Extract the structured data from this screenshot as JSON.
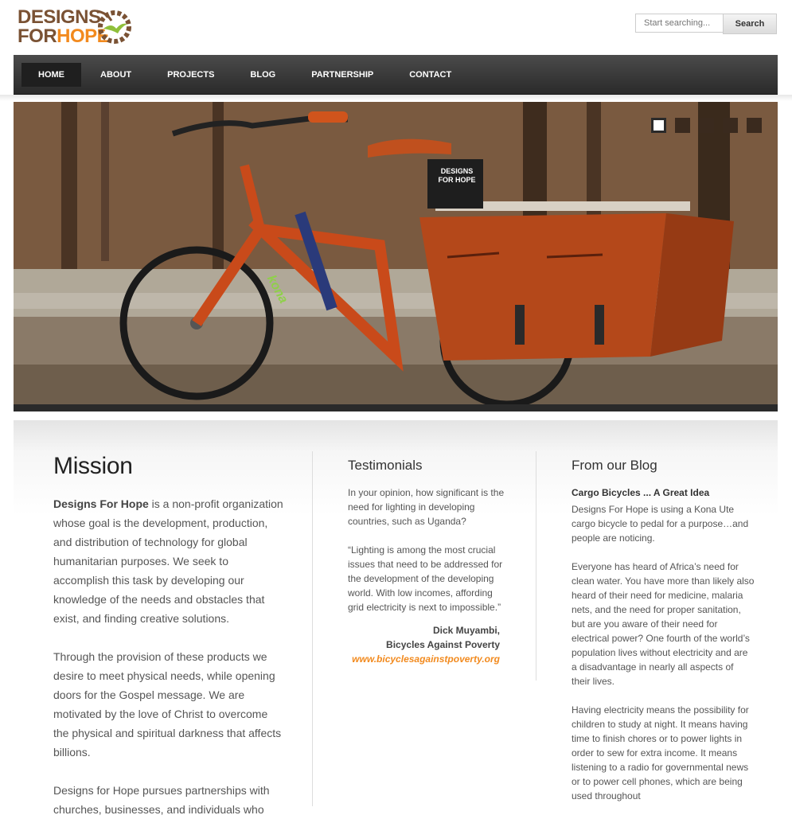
{
  "header": {
    "logo_line1": "DESIGNS",
    "logo_for": "FOR",
    "logo_hope": "HOPE",
    "search_placeholder": "Start searching...",
    "search_button": "Search"
  },
  "nav": {
    "items": [
      {
        "label": "HOME",
        "active": true
      },
      {
        "label": "ABOUT"
      },
      {
        "label": "PROJECTS"
      },
      {
        "label": "BLOG"
      },
      {
        "label": "PARTNERSHIP"
      },
      {
        "label": "CONTACT"
      }
    ]
  },
  "hero": {
    "crate_line1": "DESIGNS",
    "crate_line2": "FOR HOPE",
    "bike_brand": "kona",
    "slides": 5,
    "active_slide": 1
  },
  "mission": {
    "title": "Mission",
    "p1_bold": "Designs For Hope",
    "p1_rest": " is a non-profit organization whose goal is the development, production, and distribution of technology for global humanitarian purposes. We seek to accomplish this task by developing our knowledge of the needs and obstacles that exist, and finding creative solutions.",
    "p2": "Through the provision of these products we desire to meet physical needs, while opening doors for the Gospel message. We are motivated by the love of Christ to overcome the physical and spiritual darkness that affects billions.",
    "p3": "Designs for Hope pursues partnerships with churches, businesses, and individuals who"
  },
  "testimonials": {
    "title": "Testimonials",
    "question": "In your opinion, how significant is the need for lighting in developing countries, such as Uganda?",
    "quote": "“Lighting is among the most crucial issues that need to be addressed for the development of the developing world. With low incomes, affording grid electricity is next to impossible.”",
    "author": "Dick Muyambi,",
    "org": "Bicycles Against Poverty",
    "link": "www.bicyclesagainstpoverty.org"
  },
  "blog": {
    "title": "From our Blog",
    "post_title": "Cargo Bicycles ... A Great Idea",
    "p1": "Designs For Hope is using a Kona Ute cargo bicycle to pedal for a purpose…and people are noticing.",
    "p2": "Everyone has heard of Africa’s need for clean water. You have more than likely also heard of their need for medicine, malaria nets, and the need for proper sanitation, but are you aware of their need for electrical power? One fourth of the world’s population lives without electricity and are a disadvantage in nearly all aspects of their lives.",
    "p3": "Having electricity means the possibility for children to study at night. It means having time to finish chores or to power lights in order to sew for extra income. It means listening to a radio for governmental news or to power cell phones, which are being used throughout"
  },
  "colors": {
    "brand_brown": "#7a5234",
    "brand_orange": "#f28a1e",
    "nav_dark": "#2a2a2a"
  }
}
